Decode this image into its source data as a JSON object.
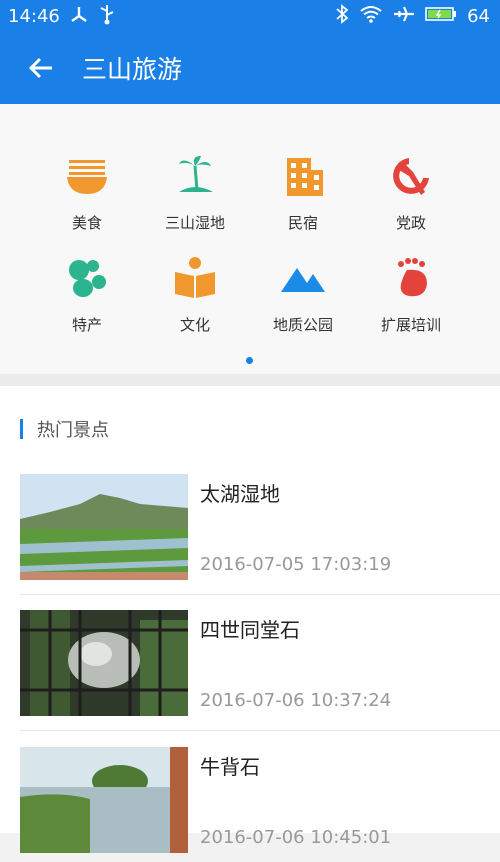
{
  "status": {
    "time": "14:46",
    "battery": "64",
    "icons": [
      "usb-debug-icon",
      "usb-icon",
      "bluetooth-icon",
      "wifi-icon",
      "airplane-icon",
      "battery-icon"
    ]
  },
  "appbar": {
    "title": "三山旅游",
    "back_icon": "back-arrow-icon"
  },
  "categories": [
    {
      "label": "美食",
      "icon": "food-bowl-icon"
    },
    {
      "label": "三山湿地",
      "icon": "palm-island-icon"
    },
    {
      "label": "民宿",
      "icon": "building-icon"
    },
    {
      "label": "党政",
      "icon": "hammer-sickle-icon"
    },
    {
      "label": "特产",
      "icon": "specialty-icon"
    },
    {
      "label": "文化",
      "icon": "book-icon"
    },
    {
      "label": "地质公园",
      "icon": "mountain-icon"
    },
    {
      "label": "扩展培训",
      "icon": "footprint-icon"
    }
  ],
  "pager": {
    "current": 1,
    "total": 1
  },
  "hot": {
    "section_title": "热门景点",
    "items": [
      {
        "name": "太湖湿地",
        "time": "2016-07-05 17:03:19"
      },
      {
        "name": "四世同堂石",
        "time": "2016-07-06 10:37:24"
      },
      {
        "name": "牛背石",
        "time": "2016-07-06 10:45:01"
      }
    ]
  },
  "colors": {
    "primary": "#1a7fe6",
    "orange": "#f0982e",
    "teal": "#2bb48f",
    "red": "#e4433c"
  }
}
